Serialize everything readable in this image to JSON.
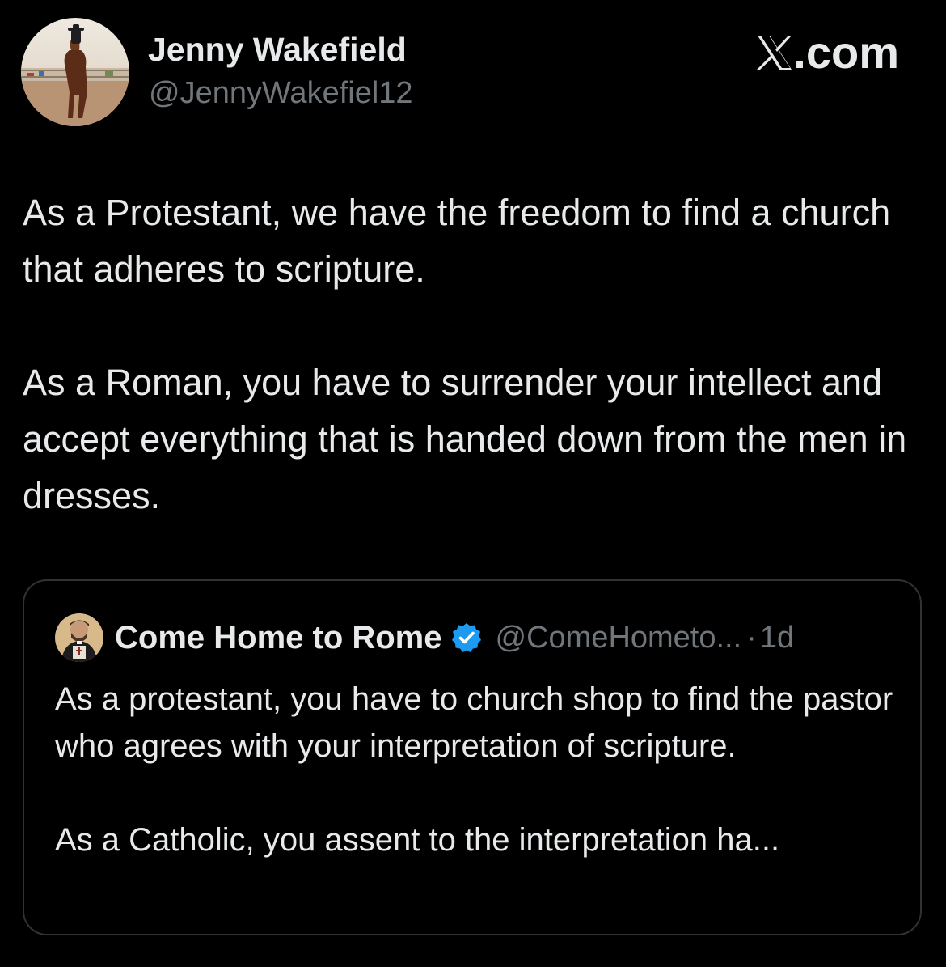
{
  "author": {
    "display_name": "Jenny Wakefield",
    "handle": "@JennyWakefiel12",
    "avatar_icon": "horse-rider-avatar"
  },
  "brand": {
    "logo_icon": "x-logo-icon",
    "suffix": ".com"
  },
  "post": {
    "paragraphs": [
      "As a Protestant, we have the freedom to find a church that adheres to scripture.",
      "As a Roman, you have to surrender your intellect and accept everything that is handed down from the men in dresses."
    ]
  },
  "quoted_post": {
    "display_name": "Come Home to Rome",
    "verified": true,
    "verified_color": "#1d9bf0",
    "handle": "@ComeHometo...",
    "separator": "·",
    "time": "1d",
    "avatar_icon": "priest-avatar",
    "paragraphs": [
      "As a protestant, you have to church shop to find the pastor who agrees with your interpretation of scripture.",
      "As a Catholic, you assent to the interpretation ha..."
    ]
  },
  "colors": {
    "background": "#000000",
    "primary_text": "#e7e9ea",
    "secondary_text": "#71767b",
    "border": "#2f3336"
  }
}
